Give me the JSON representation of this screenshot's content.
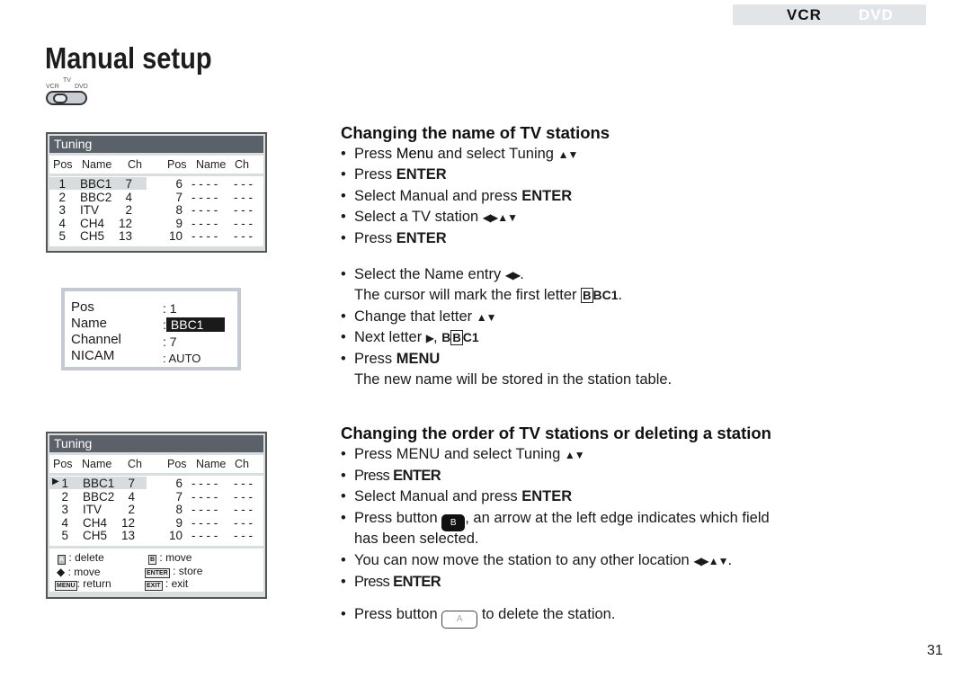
{
  "header": {
    "tabs": [
      "VCR",
      "DVD"
    ],
    "active_tab": "VCR"
  },
  "title": "Manual setup",
  "switch": {
    "labels": [
      "TV",
      "VCR",
      "DVD"
    ]
  },
  "tuning1": {
    "title": "Tuning",
    "columns": [
      "Pos",
      "Name",
      "Ch",
      "Pos",
      "Name",
      "Ch"
    ],
    "left": [
      [
        "1",
        "BBC1",
        "7"
      ],
      [
        "2",
        "BBC2",
        "4"
      ],
      [
        "3",
        "ITV",
        "2"
      ],
      [
        "4",
        "CH4",
        "12"
      ],
      [
        "5",
        "CH5",
        "13"
      ]
    ],
    "right": [
      [
        "6",
        "- - - -",
        "- - -"
      ],
      [
        "7",
        "- - - -",
        "- - -"
      ],
      [
        "8",
        "- - - -",
        "- - -"
      ],
      [
        "9",
        "- - - -",
        "- - -"
      ],
      [
        "10",
        "- - - -",
        "- - -"
      ]
    ]
  },
  "namebox": {
    "rows": [
      {
        "label": "Pos",
        "value": ":   1"
      },
      {
        "label": "Name",
        "value": "BBC1"
      },
      {
        "label": "Channel",
        "value": ":   7"
      },
      {
        "label": "NICAM",
        "value": ": AUTO"
      }
    ]
  },
  "tuning2": {
    "title": "Tuning",
    "legend": {
      "a_key": "A",
      "a": ": delete",
      "b_key": "B",
      "b": ": move",
      "arrows": ":  move",
      "enter_key": "ENTER",
      "enter": ":  store",
      "menu_key": "MENU",
      "menu": ": return",
      "exit_key": "EXIT",
      "exit": ": exit"
    }
  },
  "section1": {
    "heading": "Changing the name of TV stations",
    "items": [
      "Press ",
      "Menu",
      " and select Tuning ",
      "Press ",
      "ENTER",
      "Select Manual and press ",
      "ENTER",
      "Select a TV station ",
      "Press ",
      "ENTER",
      "Select the Name entry ",
      "The cursor will mark the first letter ",
      "BC1",
      "Change that letter ",
      "Next letter ",
      "C1",
      "Press ",
      "MENU",
      "The new name will be stored in the station table."
    ],
    "cursor_letter": "B"
  },
  "section2": {
    "heading": "Changing the order of TV stations or deleting a station",
    "items": [
      "Press ",
      "MENU",
      " and select Tuning ",
      "Press ",
      "ENTER",
      "Select Manual and press ",
      "ENTER",
      "Press button ",
      ", an arrow at the left edge indicates which field",
      "has been selected.",
      "You can now move the station to any other location ",
      "Press ",
      "ENTER",
      "Press button ",
      " to delete the station."
    ],
    "button_b": "B",
    "button_a": "A"
  },
  "page_number": "31"
}
